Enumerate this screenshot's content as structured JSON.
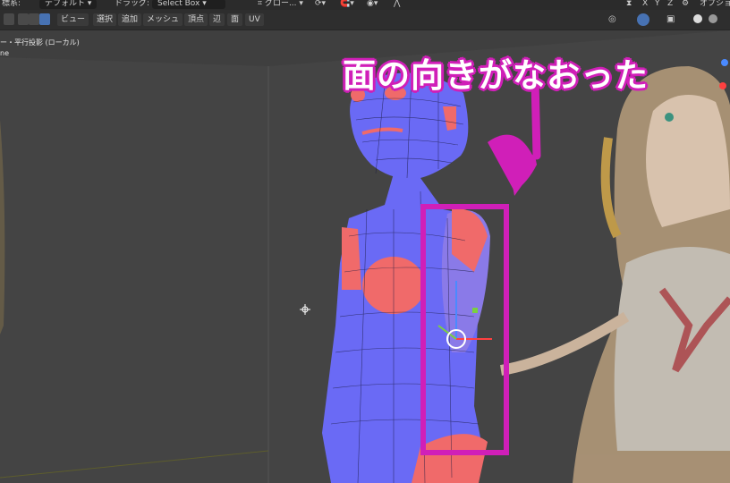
{
  "header": {
    "left_label": "標系:",
    "orientation_value": "デフォルト",
    "drag_label": "ドラッグ:",
    "drag_value": "Select Box",
    "transform_value": "グロー...",
    "axes": [
      "X",
      "Y",
      "Z"
    ],
    "options_label": "オプショ"
  },
  "menubar": {
    "items": [
      "ビュー",
      "選択",
      "追加",
      "メッシュ",
      "頂点",
      "辺",
      "面",
      "UV"
    ]
  },
  "viewport": {
    "view_info_line1": "ー・平行投影 (ローカル)",
    "view_info_line2": "ne"
  },
  "annotation": {
    "headline": "面の向きがなおった",
    "color": "#d01fb8"
  },
  "colors": {
    "face_front": "#6a6af5",
    "face_back": "#f06a6a",
    "highlight_box": "#d01fb8"
  }
}
